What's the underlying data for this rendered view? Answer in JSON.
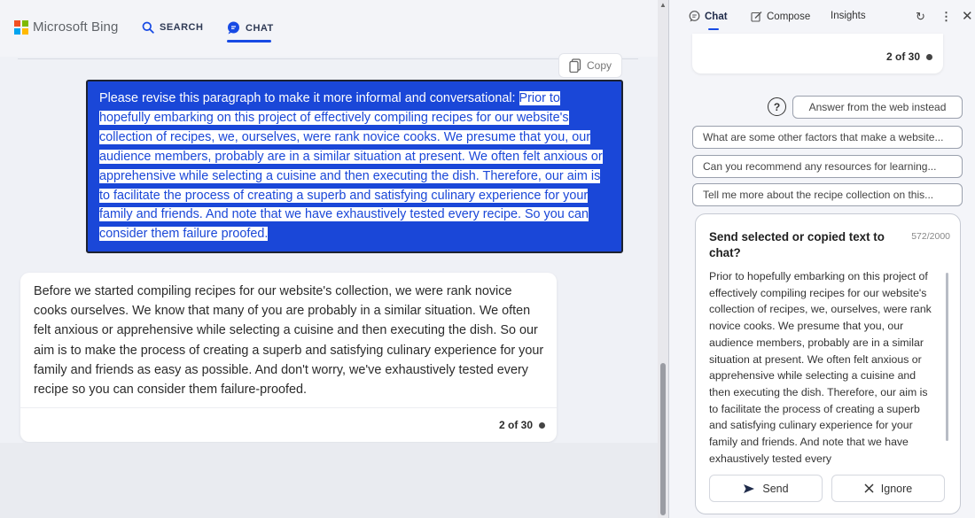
{
  "brand": {
    "name": "Microsoft Bing",
    "colors": [
      "#f25022",
      "#7fba00",
      "#00a4ef",
      "#ffb900"
    ]
  },
  "nav": {
    "search_label": "SEARCH",
    "chat_label": "CHAT",
    "accent": "#174ae4"
  },
  "copy_button": {
    "label": "Copy"
  },
  "user_message": {
    "prefix": "Please revise this paragraph to make it more informal and conversational: ",
    "highlighted": "Prior to hopefully embarking on this project of effectively compiling recipes for our website's collection of recipes, we, ourselves, were rank novice cooks. We presume that you, our audience members, probably are in a similar situation at present. We often felt anxious or apprehensive while selecting a cuisine and then executing the dish. Therefore, our aim is to facilitate the process of creating a superb and satisfying culinary experience for your family and friends. And note that we have exhaustively tested every recipe. So you can consider them failure proofed."
  },
  "bot_message": {
    "text": "Before we started compiling recipes for our website's collection, we were rank novice cooks ourselves. We know that many of you are probably in a similar situation. We often felt anxious or apprehensive while selecting a cuisine and then executing the dish. So our aim is to make the process of creating a superb and satisfying culinary experience for your family and friends as easy as possible. And don't worry, we've exhaustively tested every recipe so you can consider them failure-proofed.",
    "counter": "2 of 30"
  },
  "sidebar": {
    "tabs": {
      "chat": "Chat",
      "compose": "Compose",
      "insights": "Insights"
    },
    "prev_counter": "2 of 30",
    "web_button": "Answer from the web instead",
    "suggestions": [
      "What are some other factors that make a website...",
      "Can you recommend any resources for learning...",
      "Tell me more about the recipe collection on this..."
    ],
    "send_panel": {
      "title": "Send selected or copied text to chat?",
      "char_count": "572/2000",
      "text": "Prior to hopefully embarking on this project of effectively compiling recipes for our website's collection of recipes, we, ourselves, were rank novice cooks. We presume that you, our audience members, probably are in a similar situation at present. We often felt anxious or apprehensive while selecting a cuisine and then executing the dish. Therefore, our aim is to facilitate the process of creating a superb and satisfying culinary experience for your family and friends. And note that we have exhaustively tested every",
      "send_label": "Send",
      "ignore_label": "Ignore"
    }
  }
}
